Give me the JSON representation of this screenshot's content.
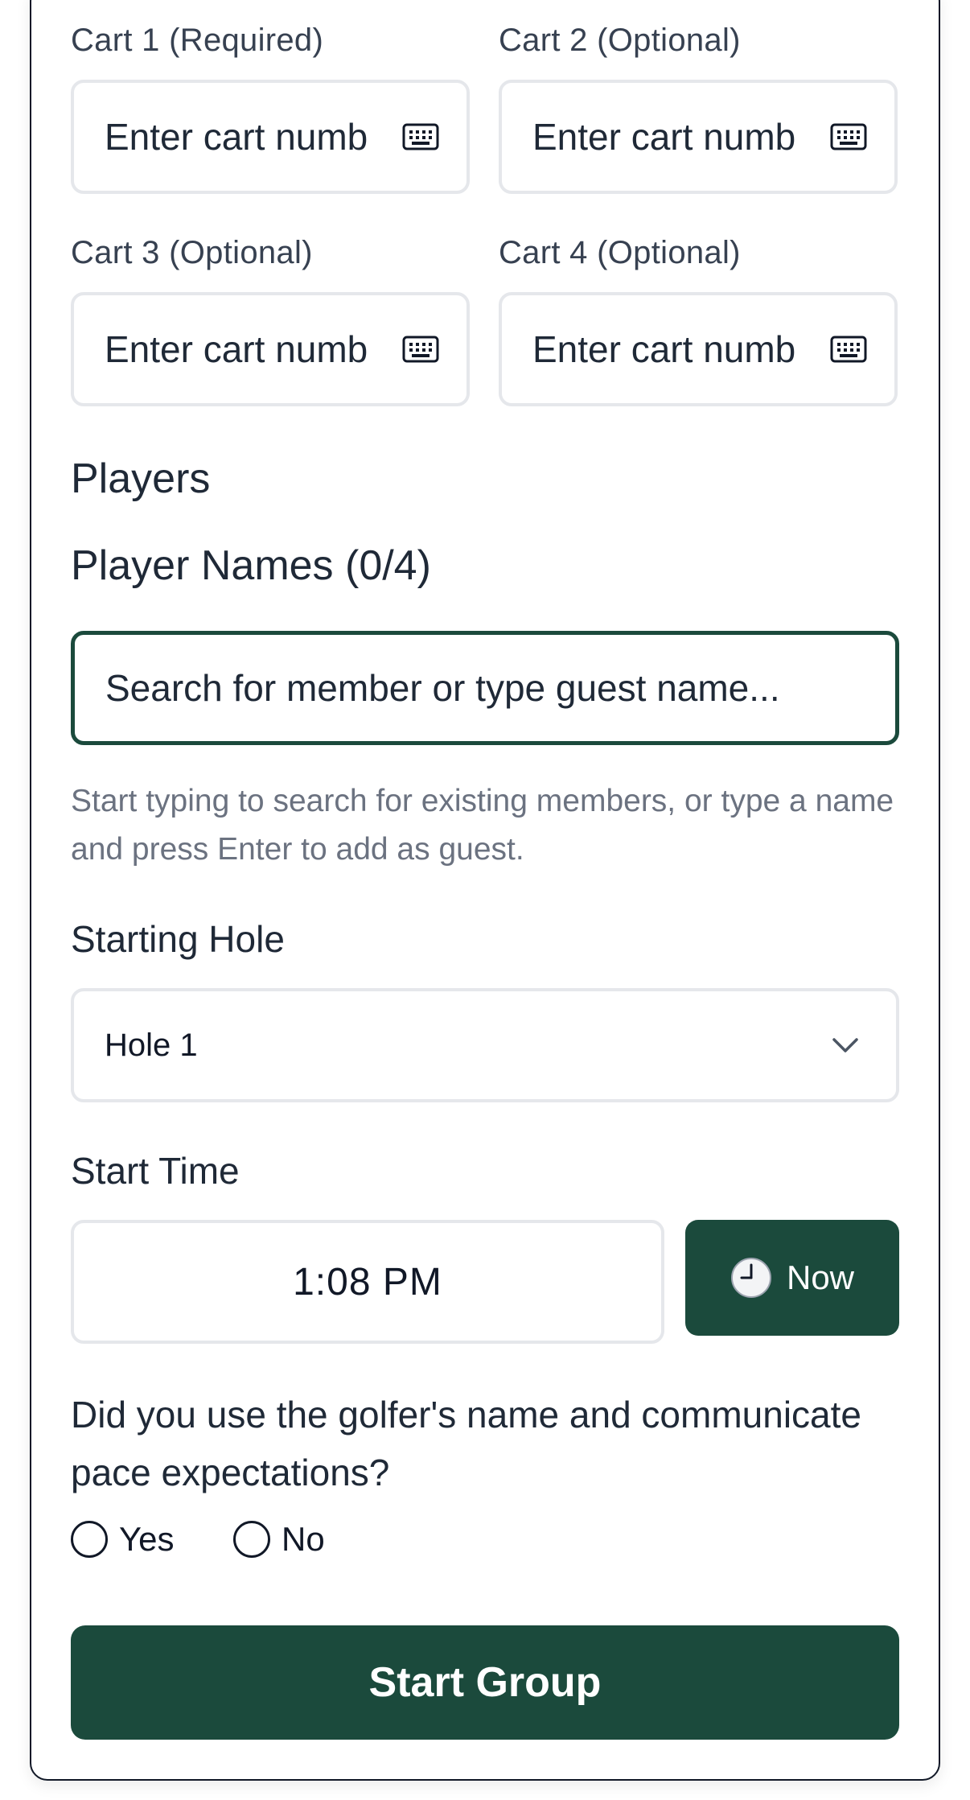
{
  "carts": [
    {
      "label": "Cart 1 (Required)",
      "placeholder": "Enter cart numb",
      "icon": "keyboard-icon"
    },
    {
      "label": "Cart 2 (Optional)",
      "placeholder": "Enter cart numb",
      "icon": "keyboard-icon"
    },
    {
      "label": "Cart 3 (Optional)",
      "placeholder": "Enter cart numb",
      "icon": "keyboard-icon"
    },
    {
      "label": "Cart 4 (Optional)",
      "placeholder": "Enter cart numb",
      "icon": "keyboard-icon"
    }
  ],
  "players": {
    "section_title": "Players",
    "names_label": "Player Names (0/4)",
    "search_placeholder": "Search for member or type guest name...",
    "helper_text": "Start typing to search for existing members, or type a name and press Enter to add as guest."
  },
  "starting_hole": {
    "label": "Starting Hole",
    "selected": "Hole 1",
    "icon": "chevron-down-icon"
  },
  "start_time": {
    "label": "Start Time",
    "value": "1:08 PM",
    "now_button": "Now",
    "now_icon": "clock-icon"
  },
  "pace_question": {
    "text": "Did you use the golfer's name and communicate pace expectations?",
    "options": [
      "Yes",
      "No"
    ]
  },
  "submit": {
    "label": "Start Group"
  },
  "colors": {
    "accent": "#1b4a3c",
    "border": "#e5e7eb",
    "muted_text": "#6b7280"
  }
}
